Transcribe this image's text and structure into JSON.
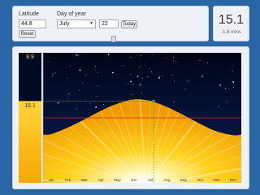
{
  "controls": {
    "latitude_label": "Latitude",
    "latitude_value": "44.8",
    "reset_label": "Reset",
    "day_label": "Day of year",
    "month_value": "July",
    "day_value": "22",
    "today_label": "Today"
  },
  "summary": {
    "day_length": "15.1",
    "change": "-1.8 mins"
  },
  "sidebar_bar": {
    "night_hours": "8.9",
    "day_hours": "15.1"
  },
  "chart_data": {
    "type": "area",
    "categories": [
      "Jan",
      "Feb",
      "Mar",
      "Apr",
      "May",
      "Jun",
      "Jul",
      "Aug",
      "Sep",
      "Oct",
      "Nov",
      "Dec"
    ],
    "series": [
      {
        "values": [
          9.0,
          10.2,
          11.7,
          13.3,
          14.6,
          15.4,
          15.1,
          14.0,
          12.5,
          10.9,
          9.5,
          8.8
        ]
      }
    ],
    "ylim": [
      0,
      24
    ],
    "selected_day_length": 15.1,
    "reference_line": 12,
    "colors": {
      "night": "#050a26",
      "day": "#f7b800",
      "selection": "#27b34a",
      "reference": "#cc2d2d"
    }
  },
  "colors": {
    "background": "#2a66a3",
    "panel": "#eef1f5"
  }
}
